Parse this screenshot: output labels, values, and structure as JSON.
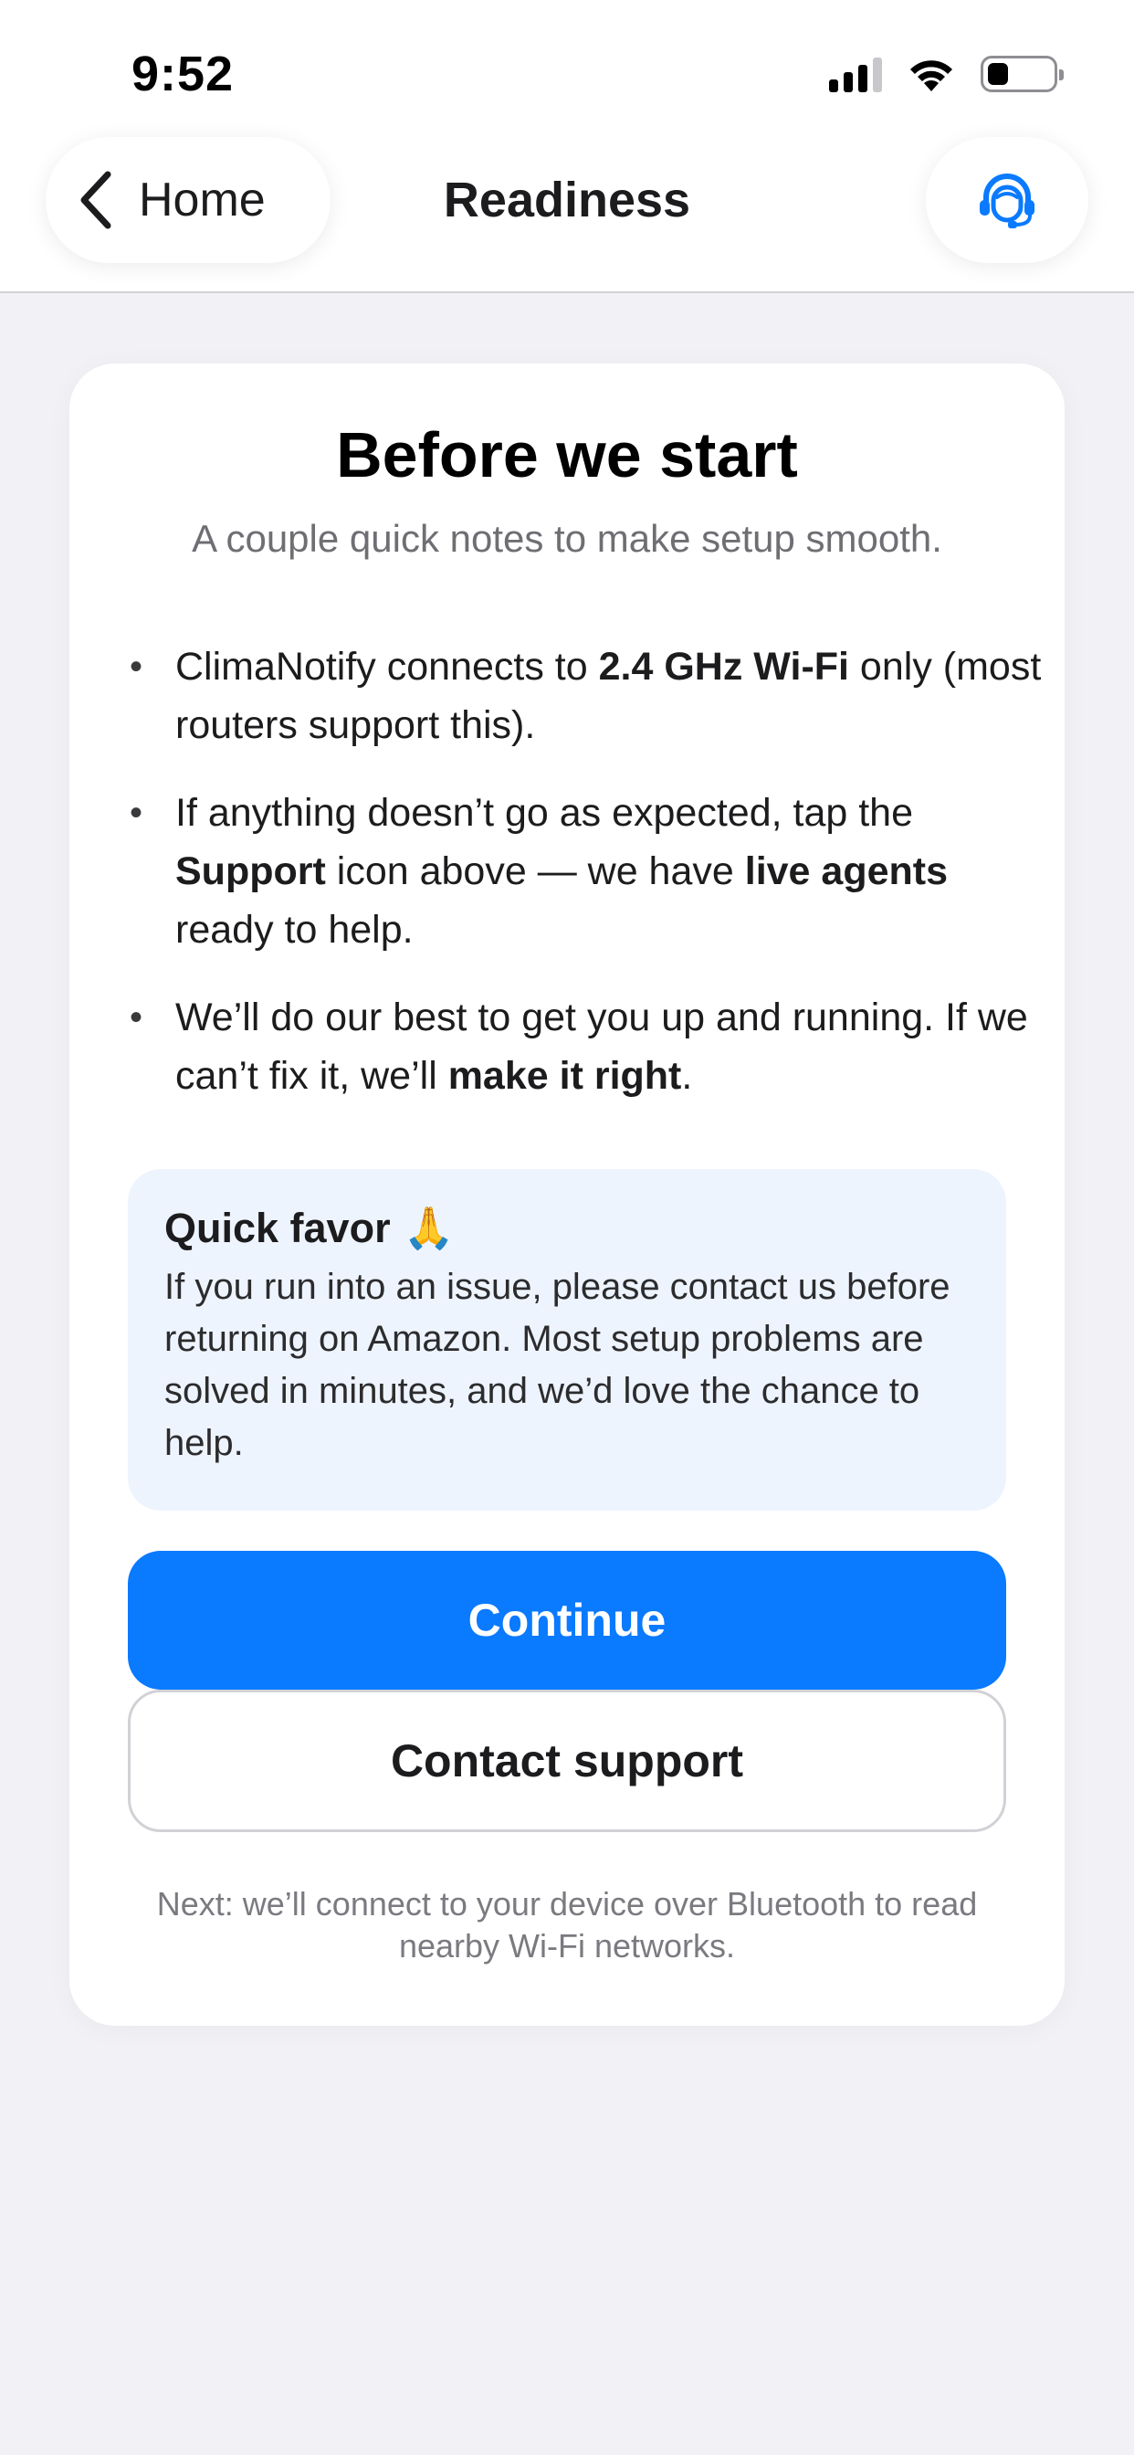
{
  "status_bar": {
    "time": "9:52"
  },
  "nav": {
    "back_label": "Home",
    "title": "Readiness"
  },
  "card": {
    "title": "Before we start",
    "subtitle": "A couple quick notes to make setup smooth.",
    "bullets": [
      {
        "p1": "ClimaNotify connects to ",
        "b1": "2.4 GHz Wi-Fi",
        "p2": " only (most routers support this)."
      },
      {
        "p1": "If anything doesn’t go as expected, tap the ",
        "b1": "Support",
        "p2": " icon above — we have ",
        "b2": "live agents",
        "p3": " ready to help."
      },
      {
        "p1": "We’ll do our best to get you up and running. If we can’t fix it, we’ll ",
        "b1": "make it right",
        "p2": "."
      }
    ],
    "favor": {
      "title": "Quick favor",
      "emoji": "🙏",
      "text": "If you run into an issue, please contact us before returning on Amazon. Most setup problems are solved in minutes, and we’d love the chance to help."
    },
    "continue_label": "Continue",
    "contact_label": "Contact support",
    "footnote": "Next: we’ll connect to your device over Bluetooth to read nearby Wi-Fi networks."
  },
  "colors": {
    "accent": "#0a7aff",
    "background": "#f2f2f6",
    "favor_bg": "#eef4fe"
  },
  "icons": {
    "back": "chevron-left-icon",
    "support": "headset-agent-icon",
    "signal": "cellular-signal-icon",
    "wifi": "wifi-icon",
    "battery": "battery-icon"
  }
}
